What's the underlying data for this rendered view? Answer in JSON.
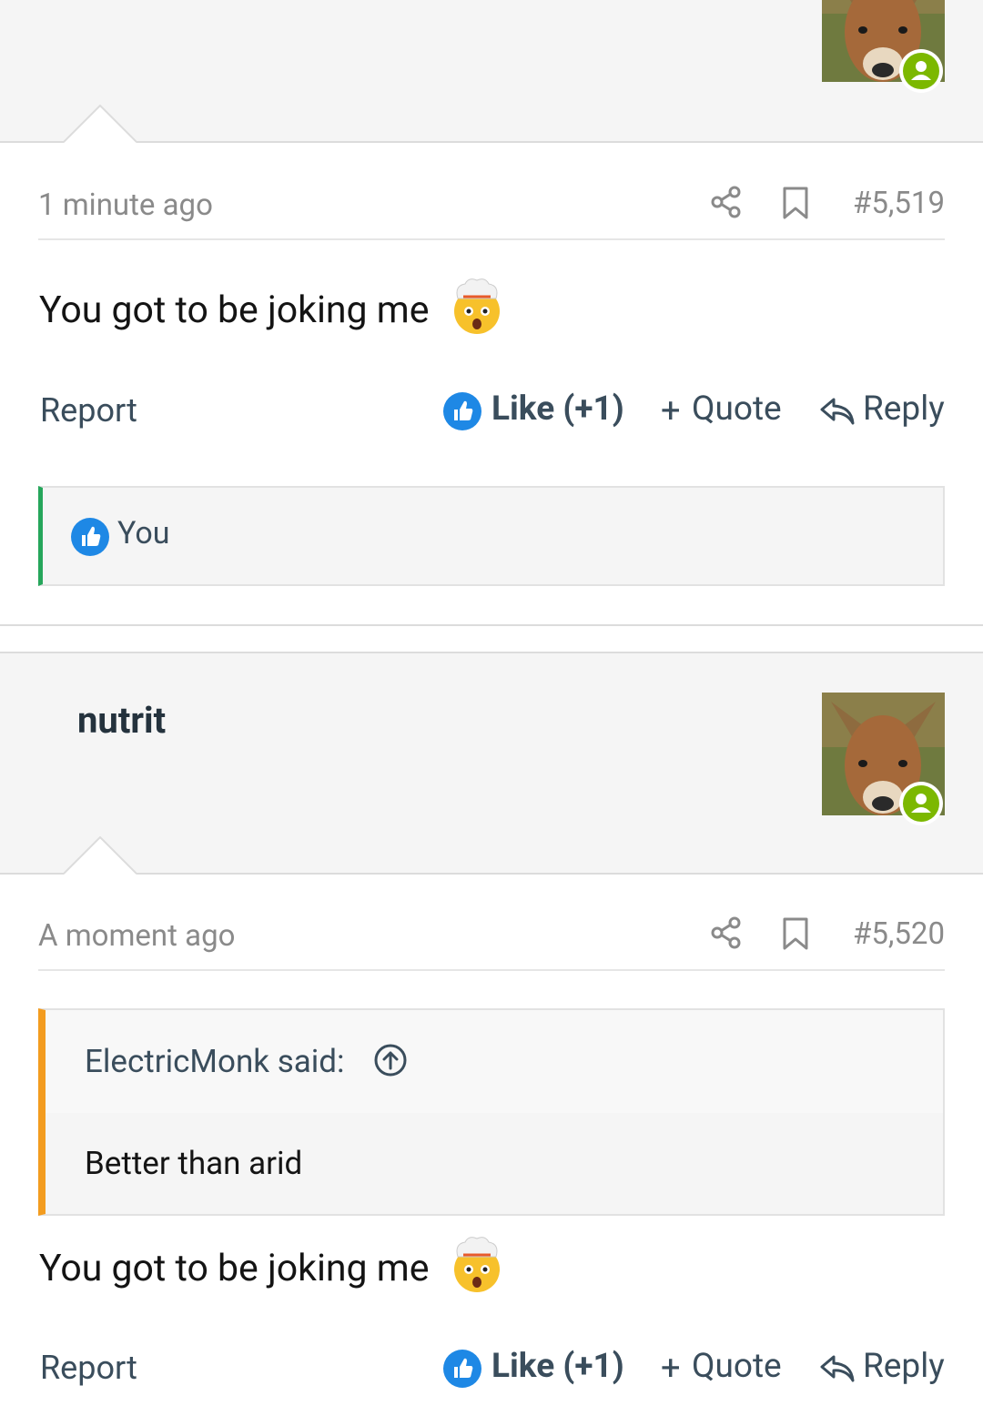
{
  "posts": [
    {
      "timestamp": "1 minute ago",
      "post_number": "#5,519",
      "body": "You got to be joking me",
      "emoji": "exploding-head-emoji",
      "actions": {
        "report": "Report",
        "like": "Like (+1)",
        "quote": "Quote",
        "reply": "Reply"
      },
      "likes_by": "You"
    },
    {
      "username": "nutrit",
      "timestamp": "A moment ago",
      "post_number": "#5,520",
      "quote": {
        "author": "ElectricMonk said:",
        "text": "Better than arid"
      },
      "body": "You got to be joking me",
      "emoji": "exploding-head-emoji",
      "actions": {
        "report": "Report",
        "like": "Like (+1)",
        "quote": "Quote",
        "reply": "Reply"
      }
    }
  ],
  "colors": {
    "online": "#7cb800",
    "like_blue": "#1e88e5",
    "likes_bar_accent": "#26a65b",
    "quote_accent": "#f39c1f",
    "link": "#3a4d5c"
  }
}
